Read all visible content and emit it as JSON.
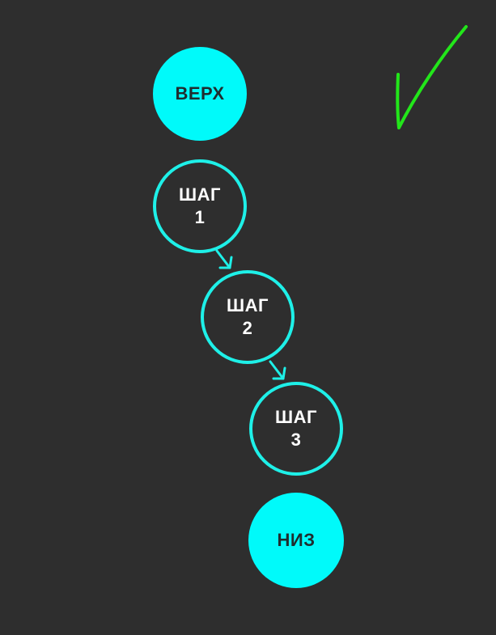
{
  "nodes": {
    "top": {
      "label": "ВЕРХ"
    },
    "step1": {
      "title": "ШАГ",
      "number": "1"
    },
    "step2": {
      "title": "ШАГ",
      "number": "2"
    },
    "step3": {
      "title": "ШАГ",
      "number": "3"
    },
    "bottom": {
      "label": "НИЗ"
    }
  },
  "colors": {
    "background": "#2e2e2e",
    "node_fill": "#00fafa",
    "node_outline": "#1ef0e8",
    "filled_text": "#1f2d2f",
    "outlined_text": "#ffffff",
    "checkmark": "#22e61a"
  },
  "icons": {
    "checkmark": "checkmark-icon"
  }
}
